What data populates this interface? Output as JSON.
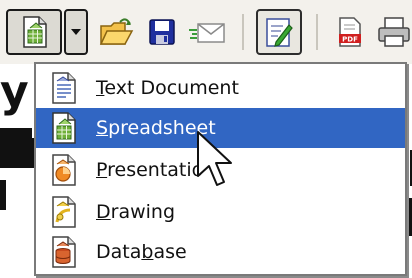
{
  "toolbar": {
    "buttons": [
      {
        "name": "new-document",
        "icon": "new-spreadsheet-icon"
      },
      {
        "name": "new-dropdown",
        "icon": "chevron-down-icon"
      },
      {
        "name": "open",
        "icon": "open-folder-icon"
      },
      {
        "name": "save",
        "icon": "floppy-disk-icon"
      },
      {
        "name": "email",
        "icon": "envelope-icon"
      },
      {
        "name": "edit-file",
        "icon": "edit-document-icon"
      },
      {
        "name": "export-pdf",
        "icon": "pdf-icon"
      },
      {
        "name": "print",
        "icon": "printer-icon"
      }
    ]
  },
  "menu": {
    "items": [
      {
        "label": "Text Document",
        "mnemonic_index": 0,
        "icon": "text-document-icon",
        "selected": false
      },
      {
        "label": "Spreadsheet",
        "mnemonic_index": 0,
        "icon": "spreadsheet-icon",
        "selected": true
      },
      {
        "label": "Presentatio",
        "mnemonic_index": 0,
        "icon": "presentation-icon",
        "selected": false
      },
      {
        "label": "Drawing",
        "mnemonic_index": 0,
        "icon": "drawing-icon",
        "selected": false
      },
      {
        "label": "Database",
        "mnemonic_index": 4,
        "icon": "database-icon",
        "selected": false
      }
    ]
  },
  "colors": {
    "toolbar_bg": "#f3f1ec",
    "selection_bg": "#3166c3",
    "menu_border": "#7a7a7a"
  }
}
